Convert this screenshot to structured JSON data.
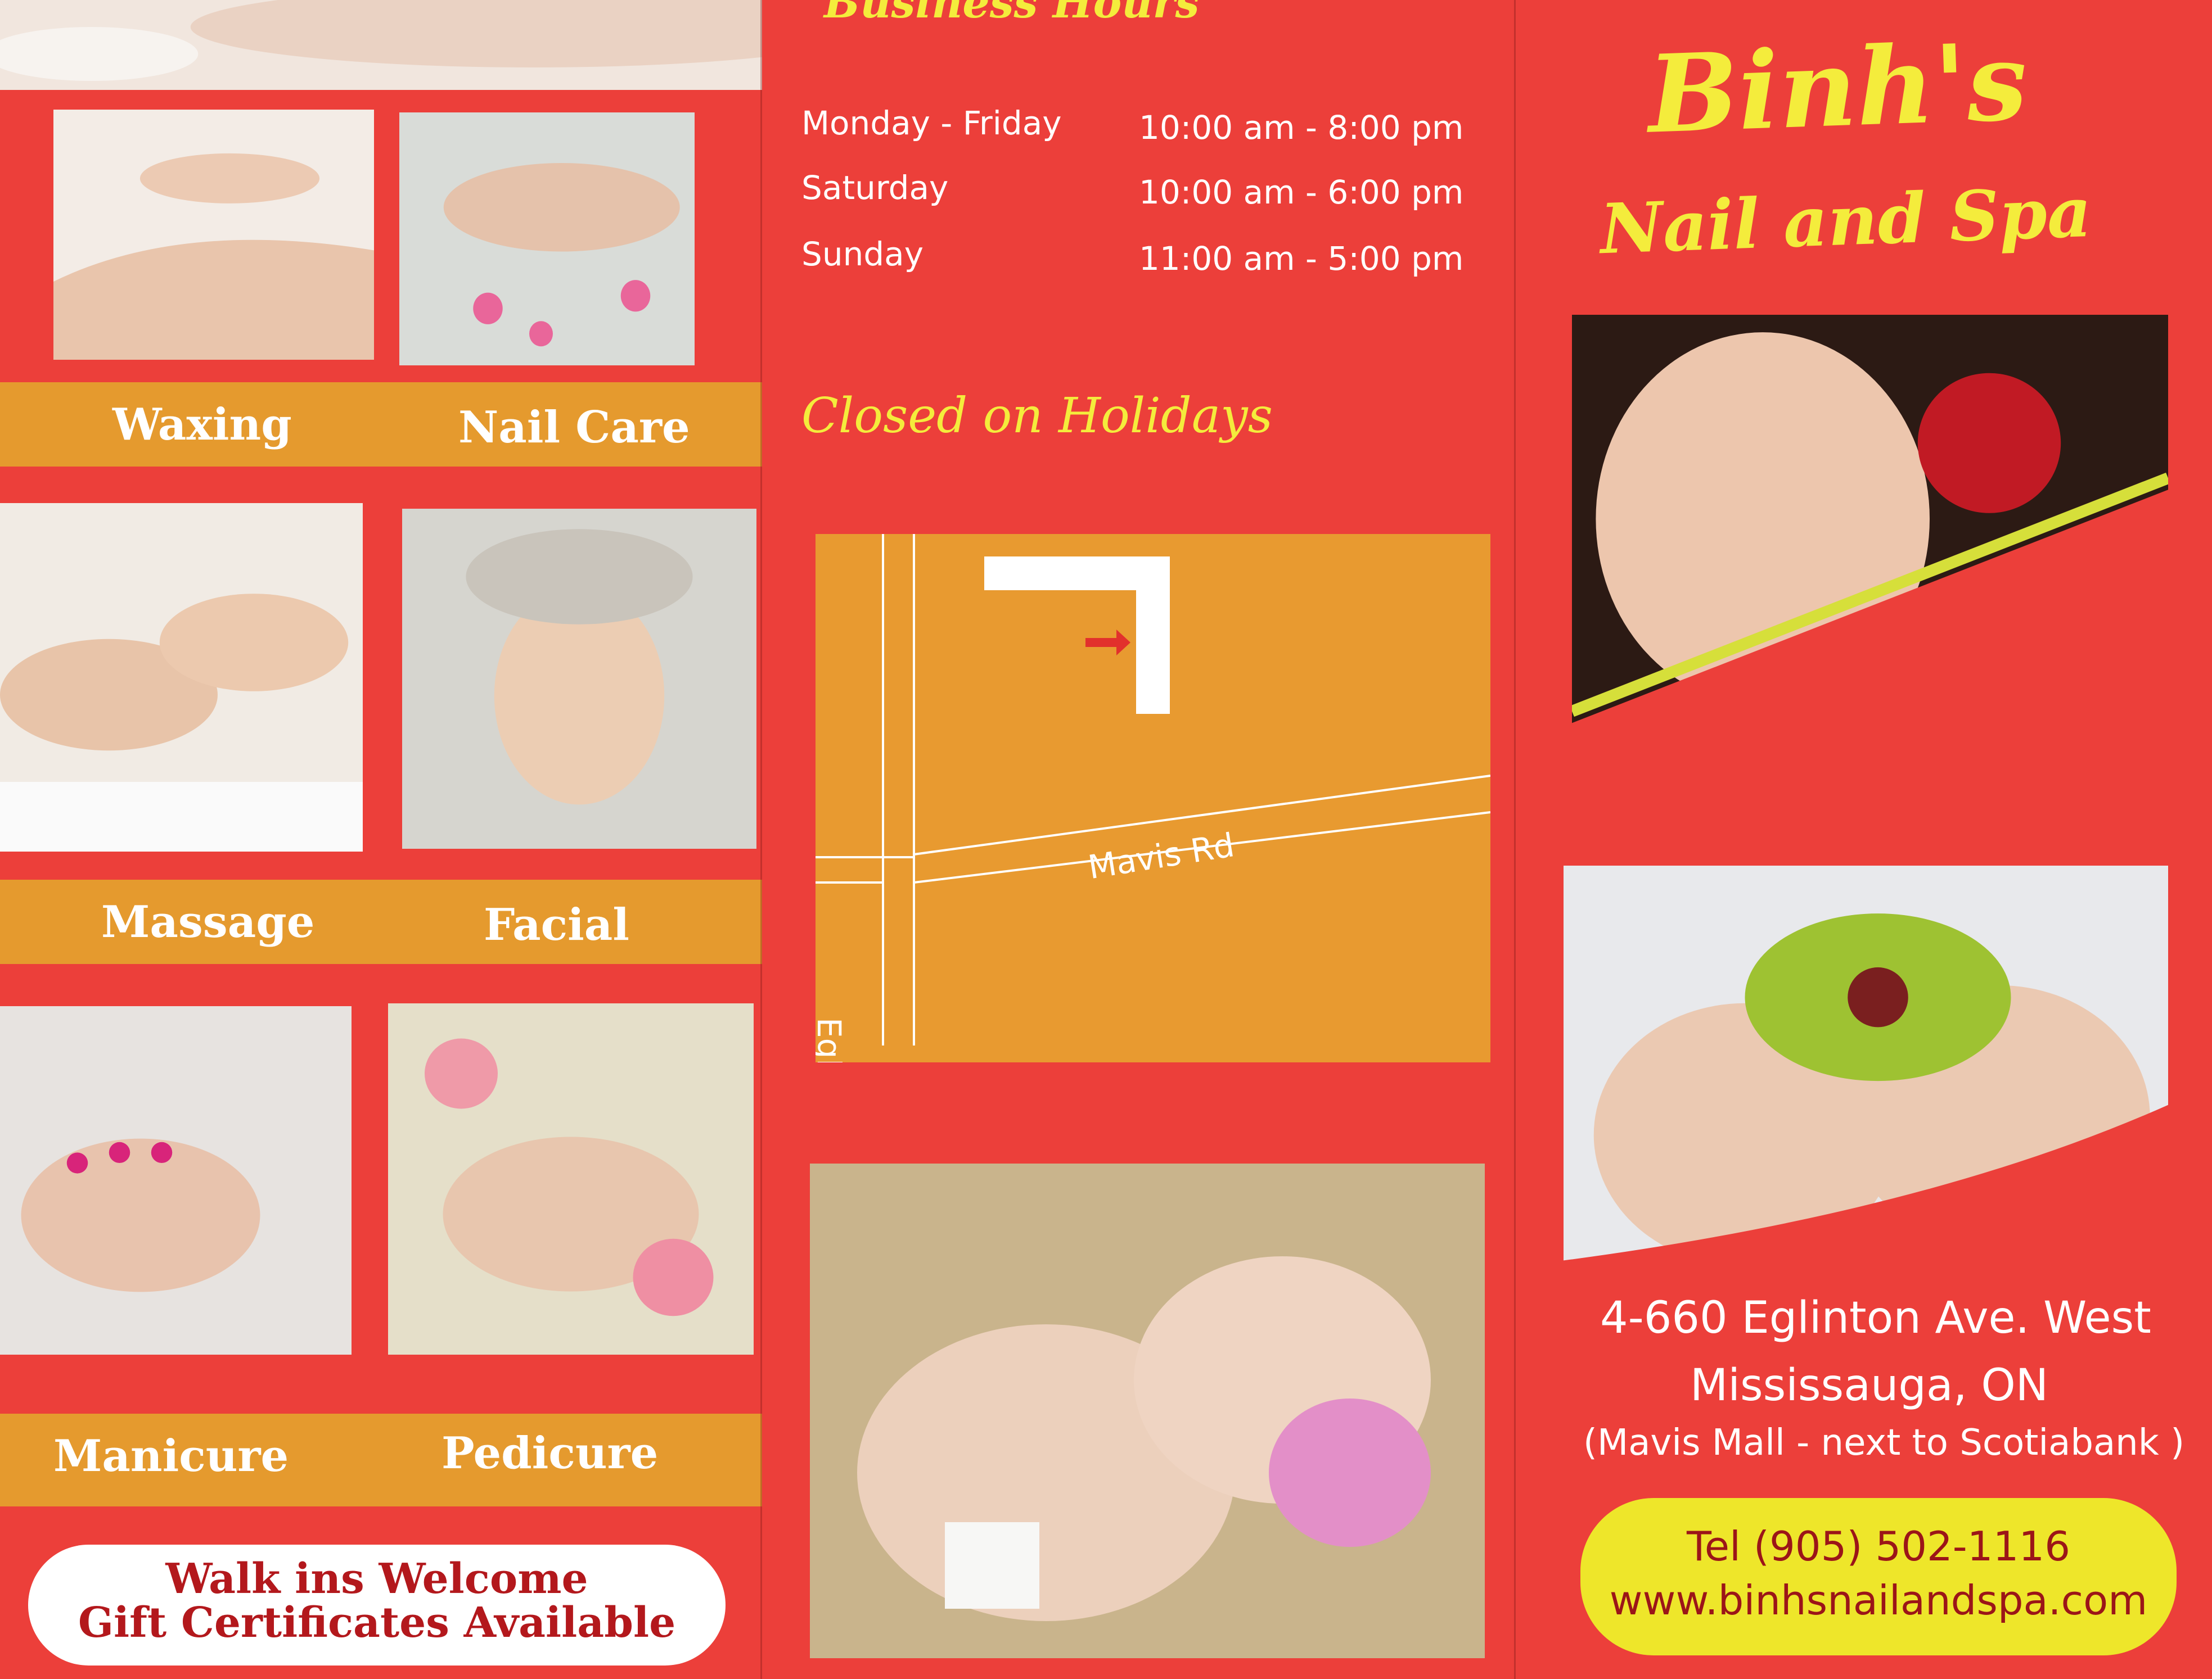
{
  "brochure": {
    "brand": {
      "name": "Binh's",
      "tagline": "Nail and Spa"
    },
    "services": [
      {
        "label": "Waxing"
      },
      {
        "label": "Nail Care"
      },
      {
        "label": "Massage"
      },
      {
        "label": "Facial"
      },
      {
        "label": "Manicure"
      },
      {
        "label": "Pedicure"
      }
    ],
    "notice": {
      "line1": "Walk ins Welcome",
      "line2": "Gift Certificates Available"
    },
    "hours": {
      "title": "Business Hours",
      "rows": [
        {
          "day": "Monday - Friday",
          "time": "10:00 am - 8:00 pm"
        },
        {
          "day": "Saturday",
          "time": "10:00 am - 6:00 pm"
        },
        {
          "day": "Sunday",
          "time": "11:00 am - 5:00 pm"
        }
      ],
      "closed": "Closed on Holidays"
    },
    "map": {
      "road_mavis": "Mavis Rd",
      "road_eglinton": "Eglinton"
    },
    "address": {
      "line1": "4-660 Eglinton Ave. West",
      "line2": "Mississauga,  ON",
      "line3": "(Mavis Mall - next to Scotiabank )"
    },
    "contact": {
      "phone": "Tel (905) 502-1116",
      "website": "www.binhsnailandspa.com"
    },
    "colors": {
      "panel_red": "#ec3f3a",
      "band_orange": "#e59a2e",
      "title_yellow": "#f4ec3c",
      "contact_yellow": "#eee62a",
      "dark_red_text": "#b3181c"
    }
  }
}
